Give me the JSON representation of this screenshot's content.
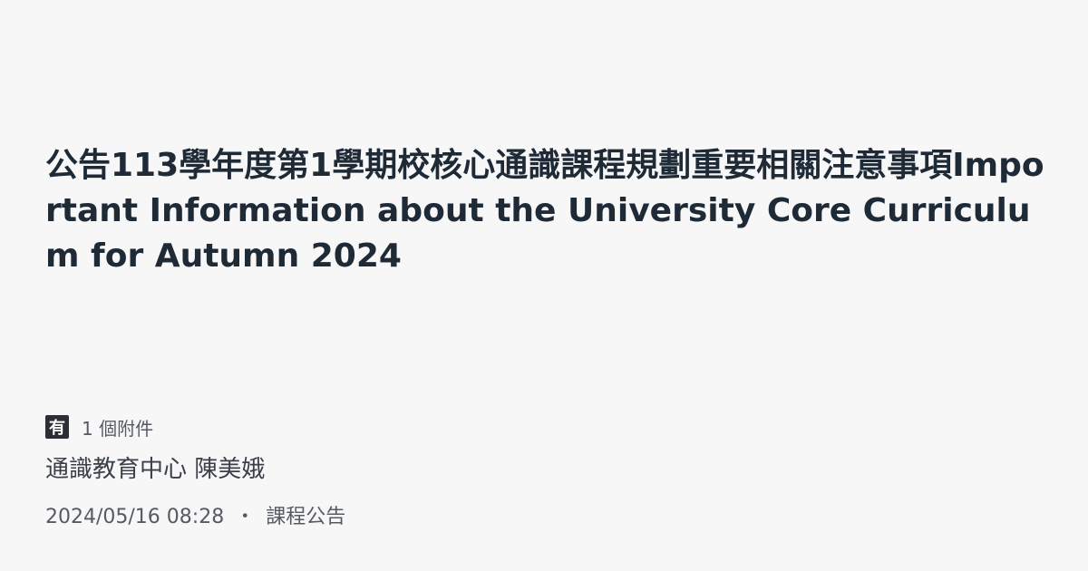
{
  "announcement": {
    "title": "公告113學年度第1學期校核心通識課程規劃重要相關注意事項Important Information about the University Core Curriculum for Autumn 2024",
    "attachment_icon_char": "有",
    "attachment_icon": "attachment-badge-icon",
    "attachments_label": "1 個附件",
    "author": "通識教育中心 陳美娥",
    "date": "2024/05/16 08:28",
    "separator": "・",
    "category": "課程公告"
  }
}
